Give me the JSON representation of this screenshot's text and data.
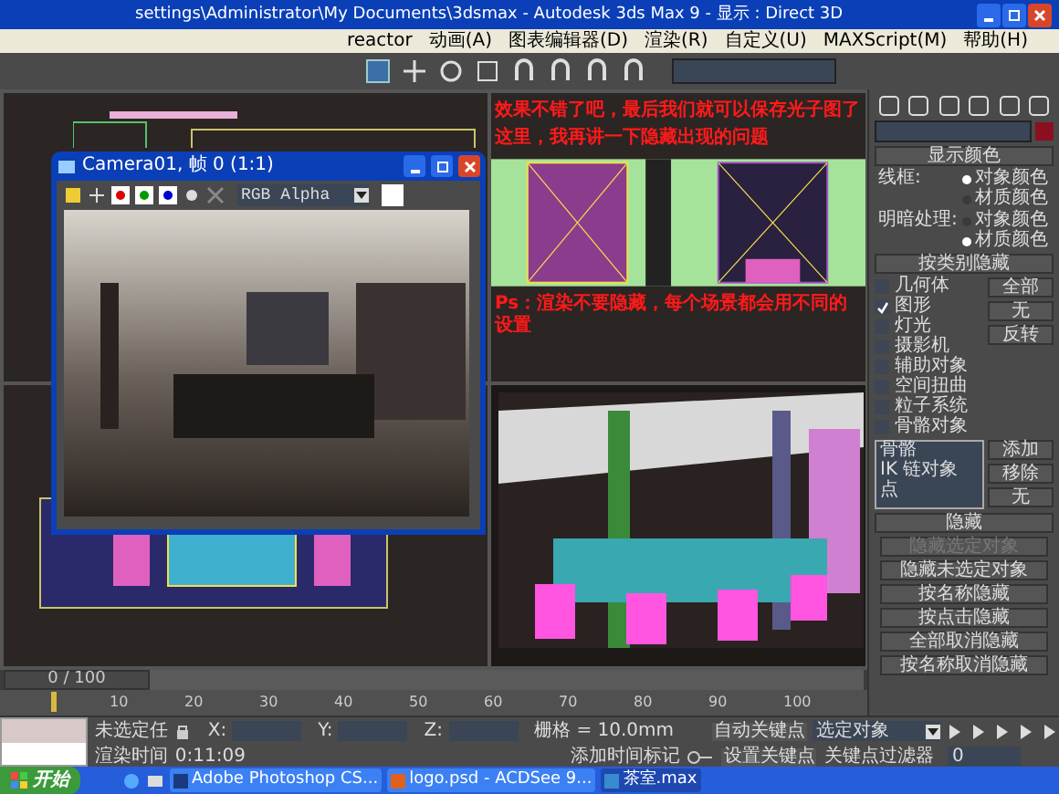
{
  "window": {
    "title": "settings\\Administrator\\My Documents\\3dsmax   -   Autodesk 3ds Max 9   -   显示 : Direct 3D"
  },
  "menu": [
    "reactor",
    "动画(A)",
    "图表编辑器(D)",
    "渲染(R)",
    "自定义(U)",
    "MAXScript(M)",
    "帮助(H)"
  ],
  "annotations": [
    "效果不错了吧，最后我们就可以保存光子图了",
    "这里，我再讲一下隐藏出现的问题",
    "Ps：渲染不要隐藏，每个场景都会用不同的设置"
  ],
  "camera_window": {
    "title": "Camera01, 帧 0 (1:1)",
    "channel": "RGB Alpha"
  },
  "command_panel": {
    "display_color": {
      "header": "显示颜色",
      "groups": [
        {
          "label": "线框:",
          "options": [
            {
              "label": "对象颜色",
              "selected": true
            },
            {
              "label": "材质颜色",
              "selected": false
            }
          ]
        },
        {
          "label": "明暗处理:",
          "options": [
            {
              "label": "对象颜色",
              "selected": false
            },
            {
              "label": "材质颜色",
              "selected": true
            }
          ]
        }
      ]
    },
    "hide_by_category": {
      "header": "按类别隐藏",
      "items": [
        {
          "label": "几何体",
          "checked": false
        },
        {
          "label": "图形",
          "checked": true
        },
        {
          "label": "灯光",
          "checked": false
        },
        {
          "label": "摄影机",
          "checked": false
        },
        {
          "label": "辅助对象",
          "checked": false
        },
        {
          "label": "空间扭曲",
          "checked": false
        },
        {
          "label": "粒子系统",
          "checked": false
        },
        {
          "label": "骨骼对象",
          "checked": false
        }
      ],
      "buttons": [
        "全部",
        "无",
        "反转"
      ],
      "list": [
        "骨骼",
        "IK 链对象",
        "点"
      ],
      "list_buttons": [
        "添加",
        "移除",
        "无"
      ]
    },
    "hide": {
      "header": "隐藏",
      "buttons": [
        {
          "label": "隐藏选定对象",
          "disabled": true
        },
        {
          "label": "隐藏未选定对象",
          "disabled": false
        },
        {
          "label": "按名称隐藏",
          "disabled": false
        },
        {
          "label": "按点击隐藏",
          "disabled": false
        },
        {
          "label": "全部取消隐藏",
          "disabled": false
        },
        {
          "label": "按名称取消隐藏",
          "disabled": false
        }
      ]
    }
  },
  "timeline": {
    "frame_counter": "0 / 100",
    "level": 0,
    "ticks": [
      "10",
      "20",
      "30",
      "40",
      "50",
      "60",
      "70",
      "80",
      "90",
      "100"
    ]
  },
  "status": {
    "selection": "未选定任",
    "x_label": "X:",
    "y_label": "Y:",
    "z_label": "Z:",
    "grid": "栅格 = 10.0mm",
    "render_time_label": "渲染时间",
    "render_time": "0:11:09",
    "add_time_tag": "添加时间标记",
    "auto_key": "自动关键点",
    "key_mode": "选定对象",
    "set_key": "设置关键点",
    "key_filters": "关键点过滤器",
    "frame": "0"
  },
  "taskbar": {
    "start": "开始",
    "tasks": [
      {
        "label": "Adobe Photoshop CS...",
        "selected": false
      },
      {
        "label": "logo.psd - ACDSee 9...",
        "selected": false
      },
      {
        "label": "茶室.max",
        "selected": true
      }
    ]
  }
}
